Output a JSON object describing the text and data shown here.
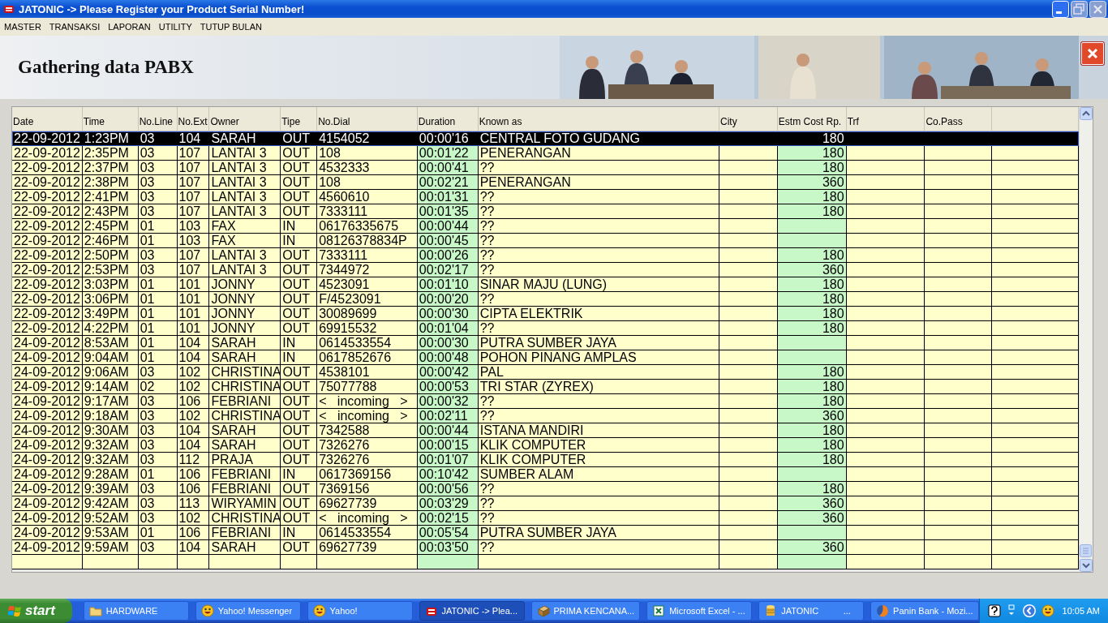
{
  "window": {
    "title": "JATONIC -> Please Register your Product Serial Number!"
  },
  "menu": [
    "MASTER",
    "TRANSAKSI",
    "LAPORAN",
    "UTILITY",
    "TUTUP BULAN"
  ],
  "header": {
    "title": "Gathering data PABX"
  },
  "table": {
    "columns": [
      {
        "label": "Date",
        "shaded": false
      },
      {
        "label": "Time",
        "shaded": false
      },
      {
        "label": "No.Line",
        "shaded": false
      },
      {
        "label": "No.Ext",
        "shaded": false
      },
      {
        "label": "Owner",
        "shaded": false
      },
      {
        "label": "Tipe",
        "shaded": false
      },
      {
        "label": "No.Dial",
        "shaded": false
      },
      {
        "label": "Duration",
        "shaded": true
      },
      {
        "label": "Known as",
        "shaded": false
      },
      {
        "label": "City",
        "shaded": false
      },
      {
        "label": "Estm Cost Rp.",
        "shaded": true
      },
      {
        "label": "Trf",
        "shaded": false
      },
      {
        "label": "Co.Pass",
        "shaded": false
      }
    ],
    "rows": [
      {
        "selected": true,
        "date": "22-09-2012",
        "time": "1:23PM",
        "line": "03",
        "ext": "104",
        "owner": "SARAH",
        "type": "OUT",
        "dial": "4154052",
        "duration": "00:00'16",
        "known_as": "CENTRAL FOTO GUDANG",
        "cost": "180"
      },
      {
        "selected": false,
        "date": "22-09-2012",
        "time": "2:35PM",
        "line": "03",
        "ext": "107",
        "owner": "LANTAI 3",
        "type": "OUT",
        "dial": "108",
        "duration": "00:01'22",
        "known_as": "PENERANGAN",
        "cost": "180"
      },
      {
        "selected": false,
        "date": "22-09-2012",
        "time": "2:37PM",
        "line": "03",
        "ext": "107",
        "owner": "LANTAI 3",
        "type": "OUT",
        "dial": "4532333",
        "duration": "00:00'41",
        "known_as": "??",
        "cost": "180"
      },
      {
        "selected": false,
        "date": "22-09-2012",
        "time": "2:38PM",
        "line": "03",
        "ext": "107",
        "owner": "LANTAI 3",
        "type": "OUT",
        "dial": "108",
        "duration": "00:02'21",
        "known_as": "PENERANGAN",
        "cost": "360"
      },
      {
        "selected": false,
        "date": "22-09-2012",
        "time": "2:41PM",
        "line": "03",
        "ext": "107",
        "owner": "LANTAI 3",
        "type": "OUT",
        "dial": "4560610",
        "duration": "00:01'31",
        "known_as": "??",
        "cost": "180"
      },
      {
        "selected": false,
        "date": "22-09-2012",
        "time": "2:43PM",
        "line": "03",
        "ext": "107",
        "owner": "LANTAI 3",
        "type": "OUT",
        "dial": "7333111",
        "duration": "00:01'35",
        "known_as": "??",
        "cost": "180"
      },
      {
        "selected": false,
        "date": "22-09-2012",
        "time": "2:45PM",
        "line": "01",
        "ext": "103",
        "owner": "FAX",
        "type": "IN",
        "dial": "06176335675",
        "duration": "00:00'44",
        "known_as": "??"
      },
      {
        "selected": false,
        "date": "22-09-2012",
        "time": "2:46PM",
        "line": "01",
        "ext": "103",
        "owner": "FAX",
        "type": "IN",
        "dial": "08126378834P",
        "duration": "00:00'45",
        "known_as": "??"
      },
      {
        "selected": false,
        "date": "22-09-2012",
        "time": "2:50PM",
        "line": "03",
        "ext": "107",
        "owner": "LANTAI 3",
        "type": "OUT",
        "dial": "7333111",
        "duration": "00:00'26",
        "known_as": "??",
        "cost": "180"
      },
      {
        "selected": false,
        "date": "22-09-2012",
        "time": "2:53PM",
        "line": "03",
        "ext": "107",
        "owner": "LANTAI 3",
        "type": "OUT",
        "dial": "7344972",
        "duration": "00:02'17",
        "known_as": "??",
        "cost": "360"
      },
      {
        "selected": false,
        "date": "22-09-2012",
        "time": "3:03PM",
        "line": "01",
        "ext": "101",
        "owner": "JONNY",
        "type": "OUT",
        "dial": "4523091",
        "duration": "00:01'10",
        "known_as": "SINAR MAJU (LUNG)",
        "cost": "180"
      },
      {
        "selected": false,
        "date": "22-09-2012",
        "time": "3:06PM",
        "line": "01",
        "ext": "101",
        "owner": "JONNY",
        "type": "OUT",
        "dial": "F/4523091",
        "duration": "00:00'20",
        "known_as": "??",
        "cost": "180"
      },
      {
        "selected": false,
        "date": "22-09-2012",
        "time": "3:49PM",
        "line": "01",
        "ext": "101",
        "owner": "JONNY",
        "type": "OUT",
        "dial": "30089699",
        "duration": "00:00'30",
        "known_as": "CIPTA ELEKTRIK",
        "cost": "180"
      },
      {
        "selected": false,
        "date": "22-09-2012",
        "time": "4:22PM",
        "line": "01",
        "ext": "101",
        "owner": "JONNY",
        "type": "OUT",
        "dial": "69915532",
        "duration": "00:01'04",
        "known_as": "??",
        "cost": "180"
      },
      {
        "selected": false,
        "date": "24-09-2012",
        "time": "8:53AM",
        "line": "01",
        "ext": "104",
        "owner": "SARAH",
        "type": "IN",
        "dial": "0614533554",
        "duration": "00:00'30",
        "known_as": "PUTRA SUMBER JAYA"
      },
      {
        "selected": false,
        "date": "24-09-2012",
        "time": "9:04AM",
        "line": "01",
        "ext": "104",
        "owner": "SARAH",
        "type": "IN",
        "dial": "0617852676",
        "duration": "00:00'48",
        "known_as": "POHON PINANG AMPLAS"
      },
      {
        "selected": false,
        "date": "24-09-2012",
        "time": "9:06AM",
        "line": "03",
        "ext": "102",
        "owner": "CHRISTINA",
        "type": "OUT",
        "dial": "4538101",
        "duration": "00:00'42",
        "known_as": "PAL",
        "cost": "180"
      },
      {
        "selected": false,
        "date": "24-09-2012",
        "time": "9:14AM",
        "line": "02",
        "ext": "102",
        "owner": "CHRISTINA",
        "type": "OUT",
        "dial": "75077788",
        "duration": "00:00'53",
        "known_as": "TRI STAR (ZYREX)",
        "cost": "180"
      },
      {
        "selected": false,
        "date": "24-09-2012",
        "time": "9:17AM",
        "line": "03",
        "ext": "106",
        "owner": "FEBRIANI",
        "type": "OUT",
        "dial": "<   incoming   >",
        "duration": "00:00'32",
        "known_as": "??",
        "cost": "180"
      },
      {
        "selected": false,
        "date": "24-09-2012",
        "time": "9:18AM",
        "line": "03",
        "ext": "102",
        "owner": "CHRISTINA",
        "type": "OUT",
        "dial": "<   incoming   >",
        "duration": "00:02'11",
        "known_as": "??",
        "cost": "360"
      },
      {
        "selected": false,
        "date": "24-09-2012",
        "time": "9:30AM",
        "line": "03",
        "ext": "104",
        "owner": "SARAH",
        "type": "OUT",
        "dial": "7342588",
        "duration": "00:00'44",
        "known_as": "ISTANA MANDIRI",
        "cost": "180"
      },
      {
        "selected": false,
        "date": "24-09-2012",
        "time": "9:32AM",
        "line": "03",
        "ext": "104",
        "owner": "SARAH",
        "type": "OUT",
        "dial": "7326276",
        "duration": "00:00'15",
        "known_as": "KLIK COMPUTER",
        "cost": "180"
      },
      {
        "selected": false,
        "date": "24-09-2012",
        "time": "9:32AM",
        "line": "03",
        "ext": "112",
        "owner": "PRAJA",
        "type": "OUT",
        "dial": "7326276",
        "duration": "00:01'07",
        "known_as": "KLIK COMPUTER",
        "cost": "180"
      },
      {
        "selected": false,
        "date": "24-09-2012",
        "time": "9:28AM",
        "line": "01",
        "ext": "106",
        "owner": "FEBRIANI",
        "type": "IN",
        "dial": "0617369156",
        "duration": "00:10'42",
        "known_as": "SUMBER ALAM"
      },
      {
        "selected": false,
        "date": "24-09-2012",
        "time": "9:39AM",
        "line": "03",
        "ext": "106",
        "owner": "FEBRIANI",
        "type": "OUT",
        "dial": "7369156",
        "duration": "00:00'56",
        "known_as": "??",
        "cost": "180"
      },
      {
        "selected": false,
        "date": "24-09-2012",
        "time": "9:42AM",
        "line": "03",
        "ext": "113",
        "owner": "WIRYAMIN",
        "type": "OUT",
        "dial": "69627739",
        "duration": "00:03'29",
        "known_as": "??",
        "cost": "360"
      },
      {
        "selected": false,
        "date": "24-09-2012",
        "time": "9:52AM",
        "line": "03",
        "ext": "102",
        "owner": "CHRISTINA",
        "type": "OUT",
        "dial": "<   incoming   >",
        "duration": "00:02'15",
        "known_as": "??",
        "cost": "360"
      },
      {
        "selected": false,
        "date": "24-09-2012",
        "time": "9:53AM",
        "line": "01",
        "ext": "106",
        "owner": "FEBRIANI",
        "type": "IN",
        "dial": "0614533554",
        "duration": "00:05'54",
        "known_as": "PUTRA SUMBER JAYA"
      },
      {
        "selected": false,
        "date": "24-09-2012",
        "time": "9:59AM",
        "line": "03",
        "ext": "104",
        "owner": "SARAH",
        "type": "OUT",
        "dial": "69627739",
        "duration": "00:03'50",
        "known_as": "??",
        "cost": "360"
      }
    ]
  },
  "taskbar": {
    "start": "start",
    "tasks": [
      {
        "kind": "folder",
        "label": "HARDWARE",
        "selected": false
      },
      {
        "kind": "smiley",
        "label": "Yahoo! Messenger",
        "selected": false
      },
      {
        "kind": "smiley",
        "label": "Yahoo!",
        "selected": false
      },
      {
        "kind": "app",
        "label": "JATONIC -> Plea...",
        "selected": true
      },
      {
        "kind": "box",
        "label": "PRIMA KENCANA...",
        "selected": false
      },
      {
        "kind": "sheet",
        "label": "Microsoft Excel - ...",
        "selected": false
      },
      {
        "kind": "db",
        "label": "JATONIC          ...",
        "selected": false
      },
      {
        "kind": "browser",
        "label": "Panin Bank - Mozi...",
        "selected": false
      }
    ],
    "clock": "10:05 AM"
  }
}
